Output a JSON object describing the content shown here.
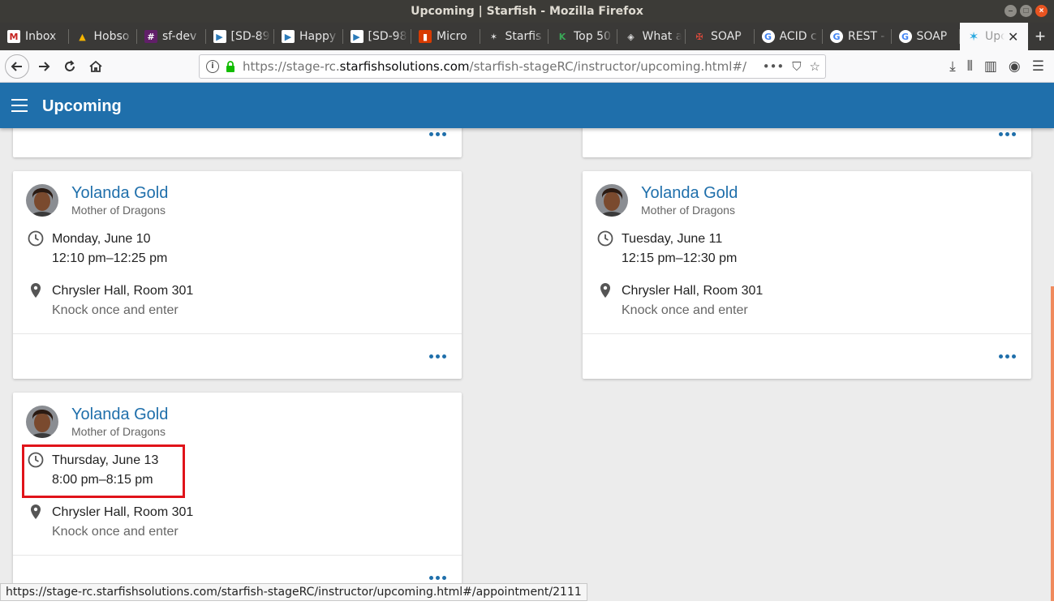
{
  "window": {
    "title": "Upcoming | Starfish - Mozilla Firefox"
  },
  "tabs": [
    {
      "label": "Inbox",
      "icon": "gmail-icon",
      "color": "#c5221f"
    },
    {
      "label": "Hobso",
      "icon": "drive-icon",
      "color": "#f4b400"
    },
    {
      "label": "sf-dev",
      "icon": "slack-icon",
      "color": "#611f69"
    },
    {
      "label": "[SD-89",
      "icon": "jira-icon",
      "color": "#2a7ab9"
    },
    {
      "label": "Happy",
      "icon": "jira-icon",
      "color": "#2a7ab9"
    },
    {
      "label": "[SD-98",
      "icon": "jira-icon",
      "color": "#2a7ab9"
    },
    {
      "label": "Micro",
      "icon": "office-icon",
      "color": "#d83b01"
    },
    {
      "label": "Starfis",
      "icon": "starfish-icon",
      "color": "#555555"
    },
    {
      "label": "Top 50",
      "icon": "k-icon",
      "color": "#3aa757"
    },
    {
      "label": "What a",
      "icon": "diamond-icon",
      "color": "#777777"
    },
    {
      "label": "SOAP",
      "icon": "cross-icon",
      "color": "#b22222"
    },
    {
      "label": "ACID c",
      "icon": "google-icon",
      "color": "#4285f4"
    },
    {
      "label": "REST -",
      "icon": "google-icon",
      "color": "#4285f4"
    },
    {
      "label": "SOAP",
      "icon": "google-icon",
      "color": "#4285f4"
    },
    {
      "label": "Upc",
      "icon": "starfish-icon",
      "color": "#2aa9e0",
      "active": true
    }
  ],
  "urlbar": {
    "prefix": "https://stage-rc.",
    "domain": "starfishsolutions.com",
    "path": "/starfish-stageRC/instructor/upcoming.html#/"
  },
  "header": {
    "title": "Upcoming"
  },
  "appointments": [
    {
      "name": "Yolanda Gold",
      "subtitle": "Mother of Dragons",
      "date": "Monday, June 10",
      "time": "12:10 pm–12:25 pm",
      "location": "Chrysler Hall, Room 301",
      "note": "Knock once and enter"
    },
    {
      "name": "Yolanda Gold",
      "subtitle": "Mother of Dragons",
      "date": "Tuesday, June 11",
      "time": "12:15 pm–12:30 pm",
      "location": "Chrysler Hall, Room 301",
      "note": "Knock once and enter"
    },
    {
      "name": "Yolanda Gold",
      "subtitle": "Mother of Dragons",
      "date": "Thursday, June 13",
      "time": "8:00 pm–8:15 pm",
      "location": "Chrysler Hall, Room 301",
      "note": "Knock once and enter"
    }
  ],
  "statusbar": {
    "url": "https://stage-rc.starfishsolutions.com/starfish-stageRC/instructor/upcoming.html#/appointment/2111"
  },
  "colors": {
    "brand": "#1f6fab",
    "highlight": "#e0131a"
  }
}
